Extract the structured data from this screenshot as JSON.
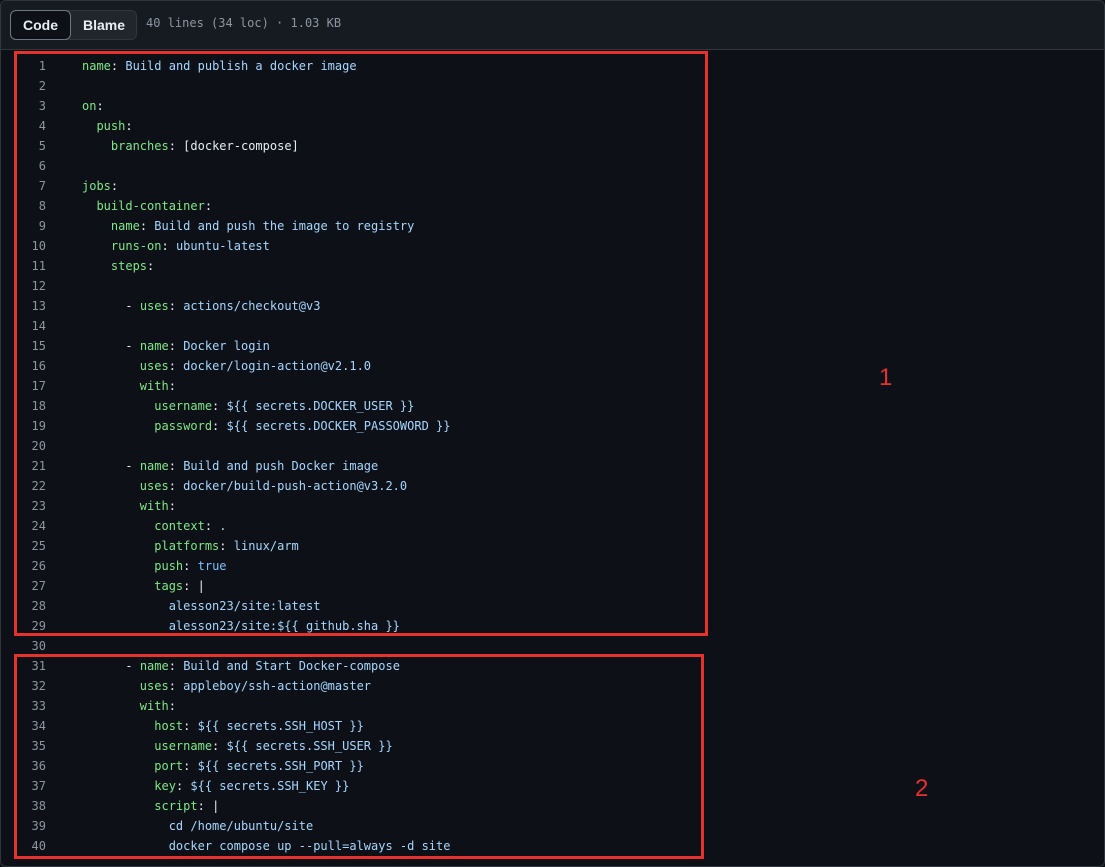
{
  "toolbar": {
    "code_label": "Code",
    "blame_label": "Blame",
    "file_info": "40 lines (34 loc) · 1.03 KB"
  },
  "annotations": {
    "box1_label": "1",
    "box2_label": "2",
    "box_color": "#e5322d"
  },
  "colors": {
    "background": "#0d1117",
    "key": "#7ee787",
    "string": "#a5d6ff",
    "boolean": "#79c0ff",
    "line_number": "#8d96a0"
  },
  "code_lines": [
    {
      "n": "1",
      "i": 0,
      "k": "name",
      "v": "Build and publish a docker image"
    },
    {
      "n": "2"
    },
    {
      "n": "3",
      "i": 0,
      "k": "on"
    },
    {
      "n": "4",
      "i": 2,
      "k": "push"
    },
    {
      "n": "5",
      "i": 4,
      "k": "branches",
      "v": "[docker-compose]",
      "vt": "plain"
    },
    {
      "n": "6"
    },
    {
      "n": "7",
      "i": 0,
      "k": "jobs"
    },
    {
      "n": "8",
      "i": 2,
      "k": "build-container"
    },
    {
      "n": "9",
      "i": 4,
      "k": "name",
      "v": "Build and push the image to registry"
    },
    {
      "n": "10",
      "i": 4,
      "k": "runs-on",
      "v": "ubuntu-latest"
    },
    {
      "n": "11",
      "i": 4,
      "k": "steps"
    },
    {
      "n": "12"
    },
    {
      "n": "13",
      "i": 6,
      "d": true,
      "k": "uses",
      "v": "actions/checkout@v3"
    },
    {
      "n": "14"
    },
    {
      "n": "15",
      "i": 6,
      "d": true,
      "k": "name",
      "v": "Docker login"
    },
    {
      "n": "16",
      "i": 8,
      "k": "uses",
      "v": "docker/login-action@v2.1.0"
    },
    {
      "n": "17",
      "i": 8,
      "k": "with"
    },
    {
      "n": "18",
      "i": 10,
      "k": "username",
      "v": "${{ secrets.DOCKER_USER }}"
    },
    {
      "n": "19",
      "i": 10,
      "k": "password",
      "v": "${{ secrets.DOCKER_PASSOWORD }}"
    },
    {
      "n": "20"
    },
    {
      "n": "21",
      "i": 6,
      "d": true,
      "k": "name",
      "v": "Build and push Docker image"
    },
    {
      "n": "22",
      "i": 8,
      "k": "uses",
      "v": "docker/build-push-action@v3.2.0"
    },
    {
      "n": "23",
      "i": 8,
      "k": "with"
    },
    {
      "n": "24",
      "i": 10,
      "k": "context",
      "v": "."
    },
    {
      "n": "25",
      "i": 10,
      "k": "platforms",
      "v": "linux/arm"
    },
    {
      "n": "26",
      "i": 10,
      "k": "push",
      "v": "true",
      "vt": "bool"
    },
    {
      "n": "27",
      "i": 10,
      "k": "tags",
      "v": "|",
      "vt": "plain"
    },
    {
      "n": "28",
      "i": 12,
      "t": "alesson23/site:latest"
    },
    {
      "n": "29",
      "i": 12,
      "t": "alesson23/site:${{ github.sha }}"
    },
    {
      "n": "30"
    },
    {
      "n": "31",
      "i": 6,
      "d": true,
      "k": "name",
      "v": "Build and Start Docker-compose"
    },
    {
      "n": "32",
      "i": 8,
      "k": "uses",
      "v": "appleboy/ssh-action@master"
    },
    {
      "n": "33",
      "i": 8,
      "k": "with"
    },
    {
      "n": "34",
      "i": 10,
      "k": "host",
      "v": "${{ secrets.SSH_HOST }}"
    },
    {
      "n": "35",
      "i": 10,
      "k": "username",
      "v": "${{ secrets.SSH_USER }}"
    },
    {
      "n": "36",
      "i": 10,
      "k": "port",
      "v": "${{ secrets.SSH_PORT }}"
    },
    {
      "n": "37",
      "i": 10,
      "k": "key",
      "v": "${{ secrets.SSH_KEY }}"
    },
    {
      "n": "38",
      "i": 10,
      "k": "script",
      "v": "|",
      "vt": "plain"
    },
    {
      "n": "39",
      "i": 12,
      "t": "cd /home/ubuntu/site"
    },
    {
      "n": "40",
      "i": 12,
      "t": "docker compose up --pull=always -d site"
    }
  ]
}
